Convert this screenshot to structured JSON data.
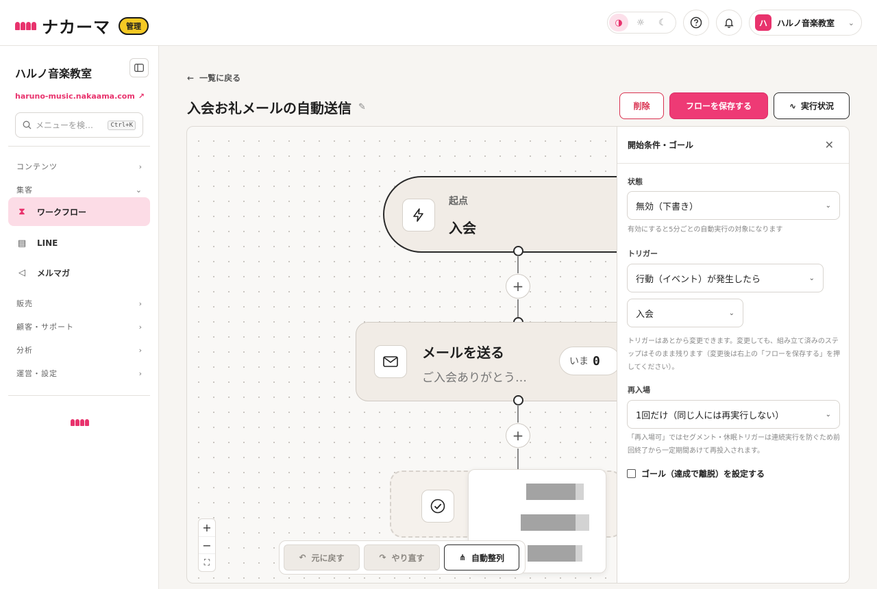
{
  "header": {
    "brand": "ナカーマ",
    "admin_badge": "管理",
    "account_initial": "ハ",
    "account_name": "ハルノ音楽教室"
  },
  "sidebar": {
    "title": "ハルノ音楽教室",
    "url": "haruno-music.nakaama.com",
    "search_placeholder": "メニューを検…",
    "search_shortcut": "Ctrl+K",
    "sections": {
      "contents": "コンテンツ",
      "marketing": "集客",
      "sales": "販売",
      "customer": "顧客・サポート",
      "analytics": "分析",
      "operations": "運営・設定"
    },
    "items": {
      "workflow": "ワークフロー",
      "line": "LINE",
      "newsletter": "メルマガ"
    }
  },
  "main": {
    "back_label": "一覧に戻る",
    "title": "入会お礼メールの自動送信",
    "delete_label": "削除",
    "save_label": "フローを保存する",
    "status_label": "実行状況"
  },
  "flow": {
    "start_label": "起点",
    "start_title": "入会",
    "mail_title": "メールを送る",
    "mail_subtitle": "ご入会ありがとう…",
    "now_label": "いま",
    "now_count": "0"
  },
  "toolbar": {
    "undo_label": "元に戻す",
    "redo_label": "やり直す",
    "auto_layout_label": "自動整列"
  },
  "panel": {
    "title": "開始条件・ゴール",
    "state_label": "状態",
    "state_value": "無効（下書き）",
    "state_hint": "有効にすると5分ごとの自動実行の対象になります",
    "trigger_label": "トリガー",
    "trigger_value": "行動（イベント）が発生したら",
    "event_value": "入会",
    "trigger_hint": "トリガーはあとから変更できます。変更しても、組み立て済みのステップはそのまま残ります（変更後は右上の「フローを保存する」を押してください）。",
    "reentry_label": "再入場",
    "reentry_value": "1回だけ（同じ人には再実行しない）",
    "reentry_hint": "「再入場可」ではセグメント・休眠トリガーは連続実行を防ぐため前回終了から一定期間あけて再投入されます。",
    "goal_checkbox_label": "ゴール（達成で離脱）を設定する"
  },
  "colors": {
    "accent": "#ee3a75",
    "admin_badge": "#f5c924"
  }
}
